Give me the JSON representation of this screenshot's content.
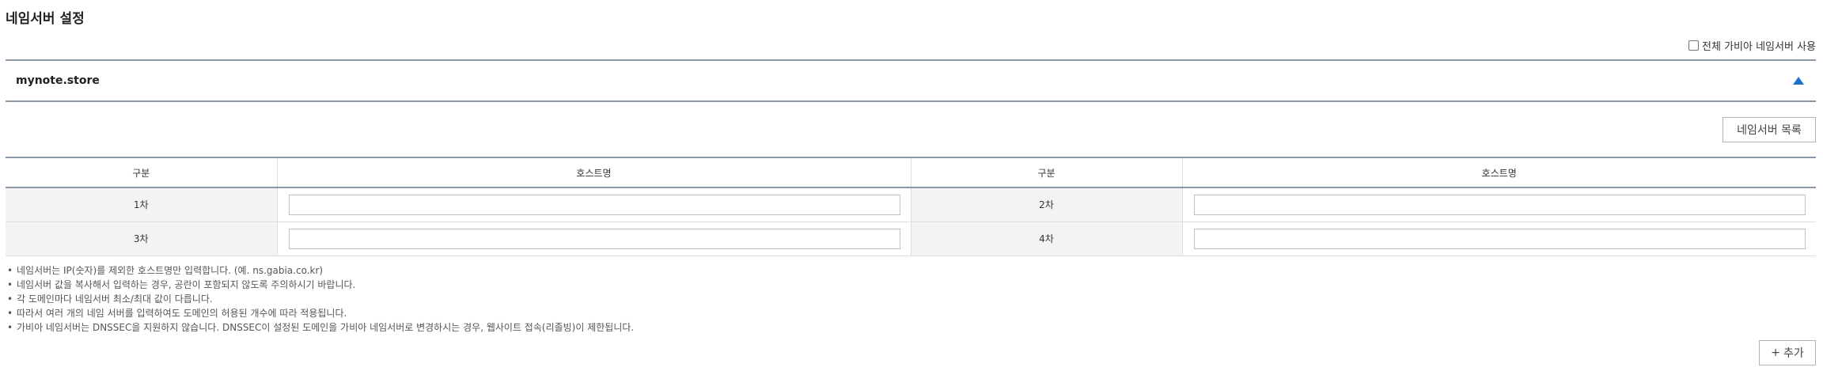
{
  "page": {
    "title": "네임서버 설정"
  },
  "use_all": {
    "label": "전체 가비아 네임서버 사용",
    "checked": false
  },
  "domain": {
    "name": "mynote.store",
    "toggle_icon": "triangle-up-icon",
    "accent": "#1a73c7"
  },
  "list_button": {
    "label": "네임서버 목록"
  },
  "table": {
    "headers": [
      "구분",
      "호스트명",
      "구분",
      "호스트명"
    ],
    "rows": [
      {
        "left_label": "1차",
        "left_value": "",
        "right_label": "2차",
        "right_value": ""
      },
      {
        "left_label": "3차",
        "left_value": "",
        "right_label": "4차",
        "right_value": ""
      }
    ]
  },
  "notes": [
    "네임서버는 IP(숫자)를 제외한 호스트명만 입력합니다. (예. ns.gabia.co.kr)",
    "네임서버 값을 복사해서 입력하는 경우, 공란이 포함되지 않도록 주의하시기 바랍니다.",
    "각 도메인마다 네임서버 최소/최대 값이 다릅니다.",
    "따라서 여러 개의 네임 서버를 입력하여도 도메인의 허용된 개수에 따라 적용됩니다.",
    "가비아 네임서버는 DNSSEC을 지원하지 않습니다. DNSSEC이 설정된 도메인을 가비아 네임서버로 변경하시는 경우, 웹사이트 접속(리졸빙)이 제한됩니다."
  ],
  "add_button": {
    "icon": "+",
    "label": "추가"
  }
}
